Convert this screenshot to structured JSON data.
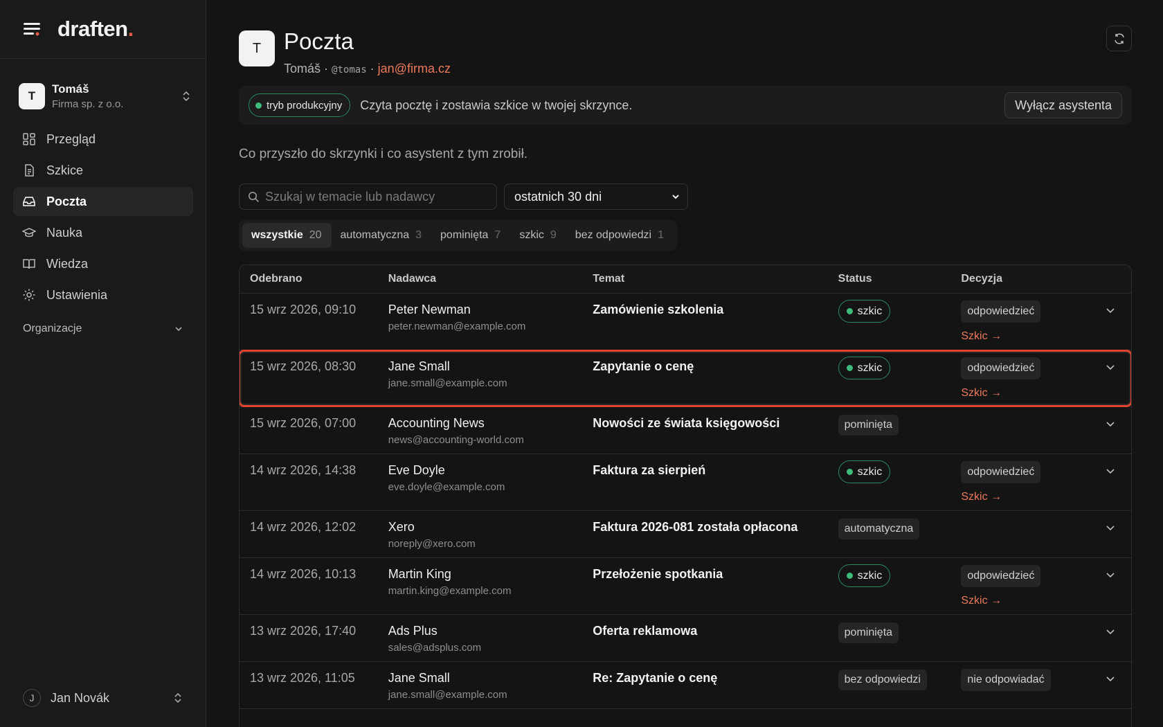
{
  "app": {
    "brand": "draften",
    "brand_dot": ".",
    "org": {
      "initial": "T",
      "name": "Tomáš",
      "sub": "Firma sp. z o.o."
    },
    "nav": [
      {
        "label": "Przegląd",
        "icon": "dashboard-icon"
      },
      {
        "label": "Szkice",
        "icon": "document-icon"
      },
      {
        "label": "Poczta",
        "icon": "inbox-icon",
        "active": true
      },
      {
        "label": "Nauka",
        "icon": "graduation-cap-icon"
      },
      {
        "label": "Wiedza",
        "icon": "book-icon"
      },
      {
        "label": "Ustawienia",
        "icon": "gear-icon"
      }
    ],
    "org_section": "Organizacje",
    "user": {
      "initial": "J",
      "name": "Jan Novák"
    }
  },
  "header": {
    "initial": "T",
    "title": "Poczta",
    "sub_name": "Tomáš",
    "sep": "·",
    "handle": "@tomas",
    "email": "jan@firma.cz"
  },
  "banner": {
    "pill": "tryb produkcyjny",
    "text": "Czyta pocztę i zostawia szkice w twojej skrzynce.",
    "button": "Wyłącz asystenta"
  },
  "intro": "Co przyszło do skrzynki i co asystent z tym zrobił.",
  "filters": {
    "search_placeholder": "Szukaj w temacie lub nadawcy",
    "range": "ostatnich 30 dni"
  },
  "tabs": [
    {
      "label": "wszystkie",
      "count": "20",
      "active": true
    },
    {
      "label": "automatyczna",
      "count": "3"
    },
    {
      "label": "pominięta",
      "count": "7"
    },
    {
      "label": "szkic",
      "count": "9"
    },
    {
      "label": "bez odpowiedzi",
      "count": "1"
    }
  ],
  "table": {
    "headers": {
      "date": "Odebrano",
      "sender": "Nadawca",
      "subject": "Temat",
      "status": "Status",
      "decision": "Decyzja"
    },
    "draft_link": "Szkic →",
    "rows": [
      {
        "date": "15 wrz 2026, 09:10",
        "name": "Peter Newman",
        "email": "peter.newman@example.com",
        "subject": "Zamówienie szkolenia",
        "status": "szkic",
        "status_kind": "pill",
        "decision": "odpowiedzieć",
        "link": true
      },
      {
        "date": "15 wrz 2026, 08:30",
        "name": "Jane Small",
        "email": "jane.small@example.com",
        "subject": "Zapytanie o cenę",
        "status": "szkic",
        "status_kind": "pill",
        "decision": "odpowiedzieć",
        "link": true,
        "highlight": true
      },
      {
        "date": "15 wrz 2026, 07:00",
        "name": "Accounting News",
        "email": "news@accounting-world.com",
        "subject": "Nowości ze świata księgowości",
        "status": "pominięta",
        "status_kind": "tag",
        "decision": "",
        "link": false
      },
      {
        "date": "14 wrz 2026, 14:38",
        "name": "Eve Doyle",
        "email": "eve.doyle@example.com",
        "subject": "Faktura za sierpień",
        "status": "szkic",
        "status_kind": "pill",
        "decision": "odpowiedzieć",
        "link": true
      },
      {
        "date": "14 wrz 2026, 12:02",
        "name": "Xero",
        "email": "noreply@xero.com",
        "subject": "Faktura 2026-081 została opłacona",
        "status": "automatyczna",
        "status_kind": "tag",
        "decision": "",
        "link": false
      },
      {
        "date": "14 wrz 2026, 10:13",
        "name": "Martin King",
        "email": "martin.king@example.com",
        "subject": "Przełożenie spotkania",
        "status": "szkic",
        "status_kind": "pill",
        "decision": "odpowiedzieć",
        "link": true
      },
      {
        "date": "13 wrz 2026, 17:40",
        "name": "Ads Plus",
        "email": "sales@adsplus.com",
        "subject": "Oferta reklamowa",
        "status": "pominięta",
        "status_kind": "tag",
        "decision": "",
        "link": false
      },
      {
        "date": "13 wrz 2026, 11:05",
        "name": "Jane Small",
        "email": "jane.small@example.com",
        "subject": "Re: Zapytanie o cenę",
        "status": "bez odpowiedzi",
        "status_kind": "tag",
        "decision": "nie odpowiadać",
        "link": false
      }
    ]
  },
  "colors": {
    "accent": "#ec7a5c",
    "status_green": "#3dbb7a",
    "highlight": "#e0462f"
  }
}
